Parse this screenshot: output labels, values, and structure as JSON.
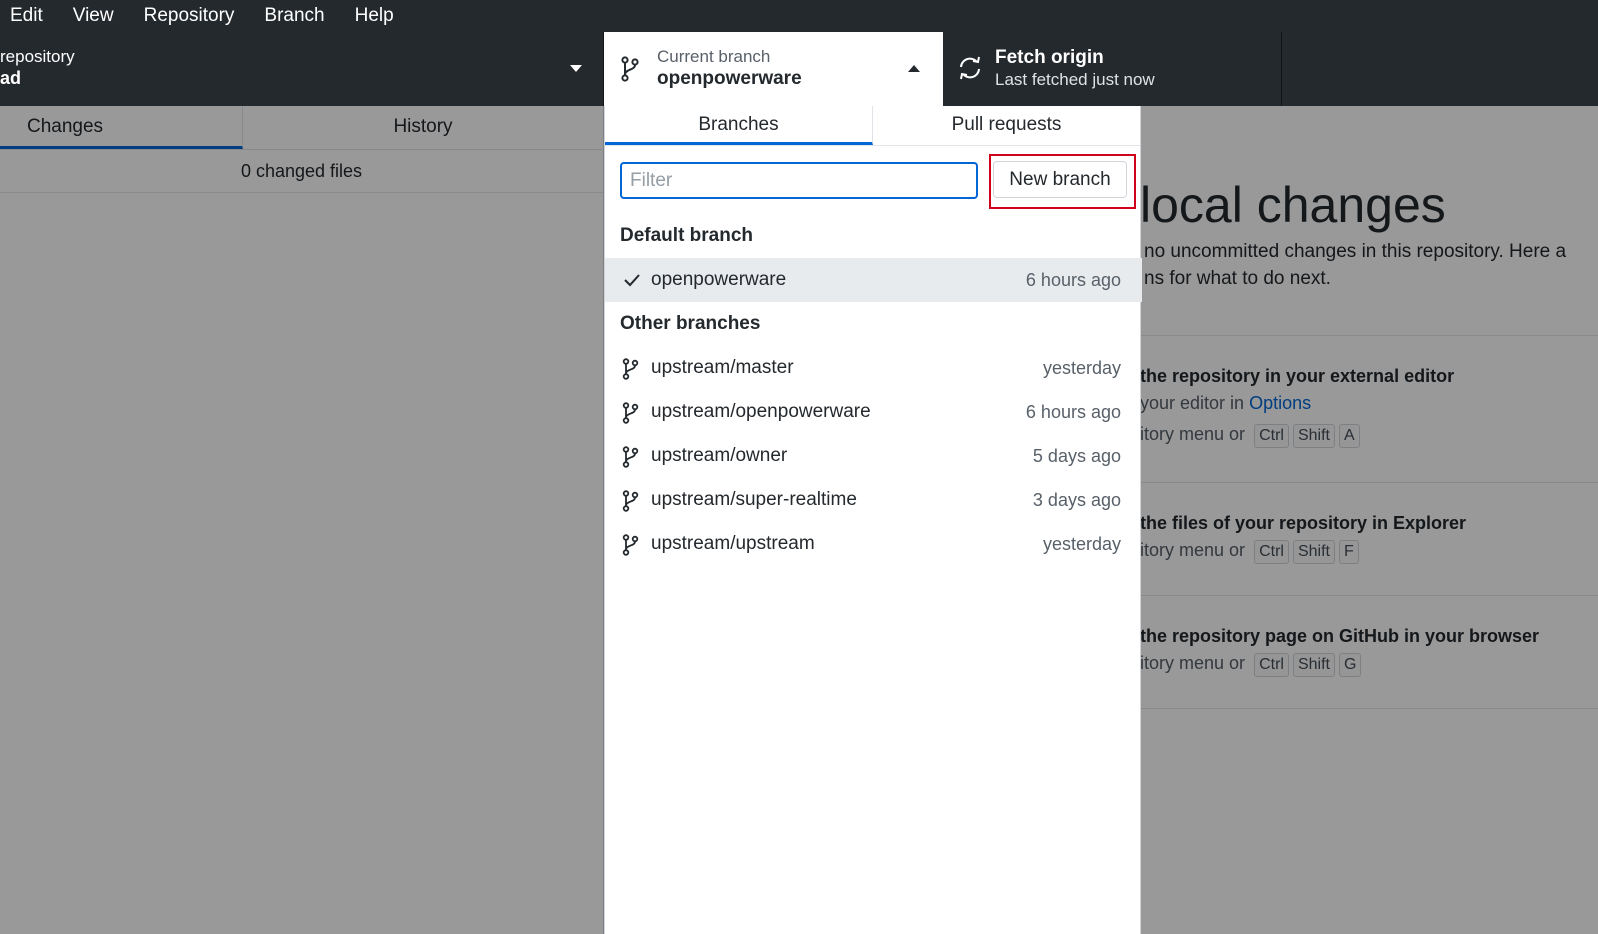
{
  "menu": [
    "Edit",
    "View",
    "Repository",
    "Branch",
    "Help"
  ],
  "toolbar": {
    "repo_label": "repository",
    "repo_value": "ad",
    "branch_label": "Current branch",
    "branch_value": "openpowerware",
    "fetch_label": "Fetch origin",
    "fetch_value": "Last fetched just now"
  },
  "left": {
    "tabs": [
      "Changes",
      "History"
    ],
    "changed_files": "0 changed files"
  },
  "right": {
    "title": "local changes",
    "intro_line1": "no uncommitted changes in this repository. Here a",
    "intro_line2": "ns for what to do next.",
    "cards": [
      {
        "title": "the repository in your external editor",
        "line1_prefix": "your editor in ",
        "line1_link": "Options",
        "line2": "itory menu or",
        "keys": [
          "Ctrl",
          "Shift",
          "A"
        ]
      },
      {
        "title": "the files of your repository in Explorer",
        "line2": "itory menu or",
        "keys": [
          "Ctrl",
          "Shift",
          "F"
        ]
      },
      {
        "title": "the repository page on GitHub in your browser",
        "line2": "itory menu or",
        "keys": [
          "Ctrl",
          "Shift",
          "G"
        ]
      }
    ]
  },
  "dropdown": {
    "tabs": [
      "Branches",
      "Pull requests"
    ],
    "filter_placeholder": "Filter",
    "new_branch_label": "New branch",
    "default_heading": "Default branch",
    "default_branch": {
      "name": "openpowerware",
      "time": "6 hours ago"
    },
    "other_heading": "Other branches",
    "other_branches": [
      {
        "name": "upstream/master",
        "time": "yesterday"
      },
      {
        "name": "upstream/openpowerware",
        "time": "6 hours ago"
      },
      {
        "name": "upstream/owner",
        "time": "5 days ago"
      },
      {
        "name": "upstream/super-realtime",
        "time": "3 days ago"
      },
      {
        "name": "upstream/upstream",
        "time": "yesterday"
      }
    ]
  },
  "colors": {
    "accent": "#0366d6",
    "highlight": "#d0021b",
    "toolbar": "#24292e"
  }
}
